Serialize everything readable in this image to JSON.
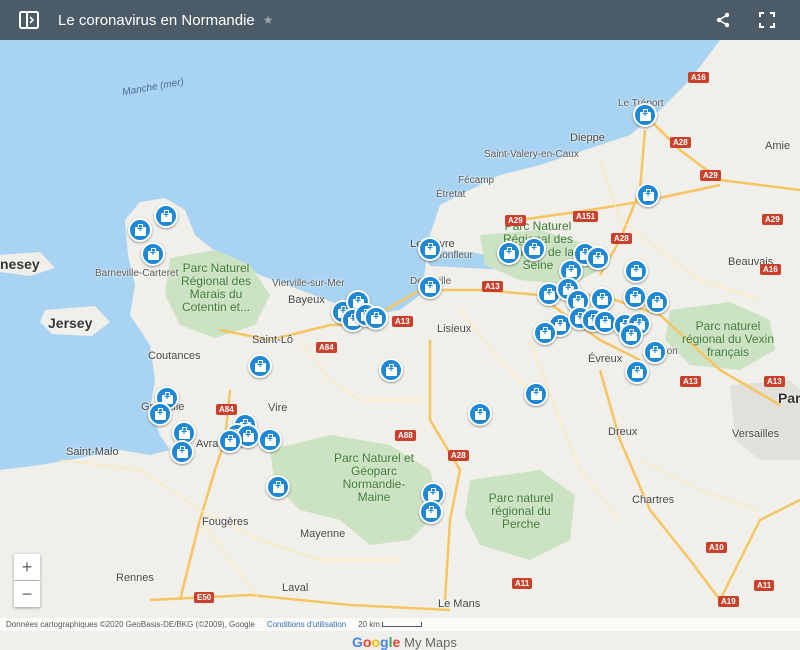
{
  "header": {
    "title": "Le coronavirus en Normandie",
    "star": "★"
  },
  "colors": {
    "header_bg": "#4b5b68",
    "sea": "#a8d3f2",
    "land": "#f1efe9",
    "park": "#cbe3c2",
    "marker": "#1e88d4",
    "motorway": "#c9412d"
  },
  "places": [
    {
      "id": "guernesey",
      "text": "nesey"
    },
    {
      "id": "jersey",
      "text": "Jersey"
    },
    {
      "id": "manche",
      "text": "Manche (mer)"
    },
    {
      "id": "letreport",
      "text": "Le Tréport"
    },
    {
      "id": "dieppe",
      "text": "Dieppe"
    },
    {
      "id": "amiens",
      "text": "Amie"
    },
    {
      "id": "stvalery",
      "text": "Saint-Valery-en-Caux"
    },
    {
      "id": "fecamp",
      "text": "Fécamp"
    },
    {
      "id": "etretat",
      "text": "Étretat"
    },
    {
      "id": "lehavre",
      "text": "Le Havre"
    },
    {
      "id": "honfleur",
      "text": "Honfleur"
    },
    {
      "id": "deauville",
      "text": "Deauville"
    },
    {
      "id": "barneville",
      "text": "Barneville-Carteret"
    },
    {
      "id": "vierville",
      "text": "Vierville-sur-Mer"
    },
    {
      "id": "bayeux",
      "text": "Bayeux"
    },
    {
      "id": "lisieux",
      "text": "Lisieux"
    },
    {
      "id": "saintlo",
      "text": "Saint-Lô"
    },
    {
      "id": "coutances",
      "text": "Coutances"
    },
    {
      "id": "vire",
      "text": "Vire"
    },
    {
      "id": "evreux",
      "text": "Évreux"
    },
    {
      "id": "beauvais",
      "text": "Beauvais"
    },
    {
      "id": "granville",
      "text": "Granville"
    },
    {
      "id": "avranches",
      "text": "Avranches"
    },
    {
      "id": "saintmalo",
      "text": "Saint-Malo"
    },
    {
      "id": "dreux",
      "text": "Dreux"
    },
    {
      "id": "versailles",
      "text": "Versailles"
    },
    {
      "id": "paris",
      "text": "Par"
    },
    {
      "id": "fougeres",
      "text": "Fougères"
    },
    {
      "id": "mayenne",
      "text": "Mayenne"
    },
    {
      "id": "chartres",
      "text": "Chartres"
    },
    {
      "id": "rennes",
      "text": "Rennes"
    },
    {
      "id": "laval",
      "text": "Laval"
    },
    {
      "id": "lemans",
      "text": "Le Mans"
    },
    {
      "id": "vernon",
      "text": "Vernon"
    }
  ],
  "parks": [
    {
      "id": "cotentin",
      "text": "Parc Naturel Régional des Marais du Cotentin et..."
    },
    {
      "id": "seine",
      "text": "Parc Naturel Régional des Boucles de la Seine"
    },
    {
      "id": "normandie-maine",
      "text": "Parc Naturel et Géoparc Normandie-Maine"
    },
    {
      "id": "perche",
      "text": "Parc naturel régional du Perche"
    },
    {
      "id": "vexin",
      "text": "Parc naturel régional du Vexin français"
    }
  ],
  "roads": [
    "A16",
    "A28",
    "A29",
    "A29",
    "A151",
    "A28",
    "A29",
    "A13",
    "A13",
    "A84",
    "A84",
    "A88",
    "A28",
    "A13",
    "A13",
    "A16",
    "E50",
    "A11",
    "A10",
    "A19",
    "A11"
  ],
  "markers_count": 60,
  "controls": {
    "zoom_in": "+",
    "zoom_out": "−"
  },
  "footer": {
    "attribution": "Données cartographiques ©2020 GeoBasis-DE/BKG (©2009), Google",
    "terms": "Conditions d'utilisation",
    "scale": "20 km"
  },
  "branding": {
    "g1": "G",
    "g2": "o",
    "g3": "o",
    "g4": "g",
    "g5": "l",
    "g6": "e",
    "product": "My Maps"
  }
}
